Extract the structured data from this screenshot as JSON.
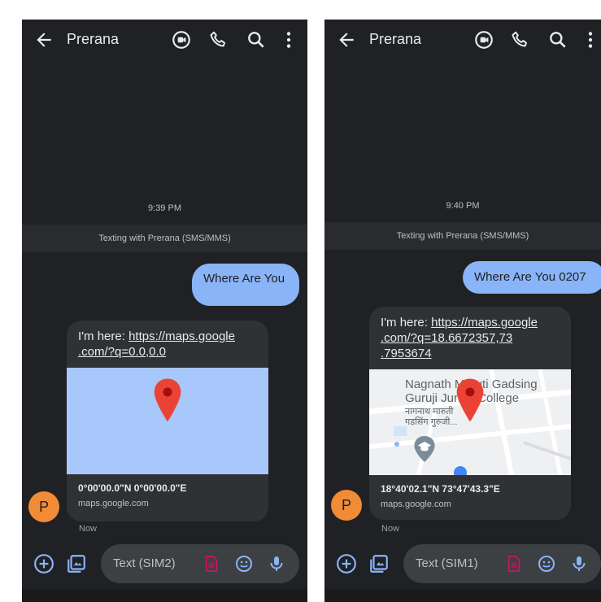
{
  "screens": [
    {
      "contact_name": "Prerana",
      "timestamp": "9:39 PM",
      "banner": "Texting with Prerana (SMS/MMS)",
      "outgoing_message": "Where Are You",
      "incoming": {
        "prefix": "I'm here: ",
        "link_line1": "https://maps.google",
        "link_line2": ".com/?q=0.0,0.0",
        "link_line3": "",
        "coordinates": "0°00'00.0\"N 0°00'00.0\"E",
        "domain": "maps.google.com"
      },
      "avatar_letter": "P",
      "status": "Now",
      "input_placeholder": "Text (SIM2)"
    },
    {
      "contact_name": "Prerana",
      "timestamp": "9:40 PM",
      "banner": "Texting with Prerana (SMS/MMS)",
      "outgoing_message": "Where Are You 0207",
      "incoming": {
        "prefix": "I'm here: ",
        "link_line1": "https://maps.google",
        "link_line2": ".com/?q=18.6672357,73",
        "link_line3": ".7953674",
        "coordinates": "18°40'02.1\"N 73°47'43.3\"E",
        "domain": "maps.google.com",
        "map_label_en_1": "Nagnath Maruti Gadsing",
        "map_label_en_2": "Guruji Junior College",
        "map_label_mr_1": "नागनाथ मारुती",
        "map_label_mr_2": "गडसिंग गुरुजी..."
      },
      "avatar_letter": "P",
      "status": "Now",
      "input_placeholder": "Text (SIM1)"
    }
  ],
  "icons": {
    "back": "arrow-back-icon",
    "video": "video-call-icon",
    "phone": "phone-icon",
    "search": "search-icon",
    "more": "more-vert-icon",
    "add": "add-circle-icon",
    "gallery": "gallery-icon",
    "sim": "sim-card-icon",
    "emoji": "emoji-icon",
    "mic": "mic-icon",
    "pin": "map-pin-icon"
  },
  "colors": {
    "background": "#202124",
    "outgoing_bubble": "#8ab4f8",
    "incoming_bubble": "#303134",
    "avatar": "#f28b36",
    "accent_icon": "#8ab4f8",
    "sim_icon": "#c2185b",
    "pin": "#ea4335"
  }
}
